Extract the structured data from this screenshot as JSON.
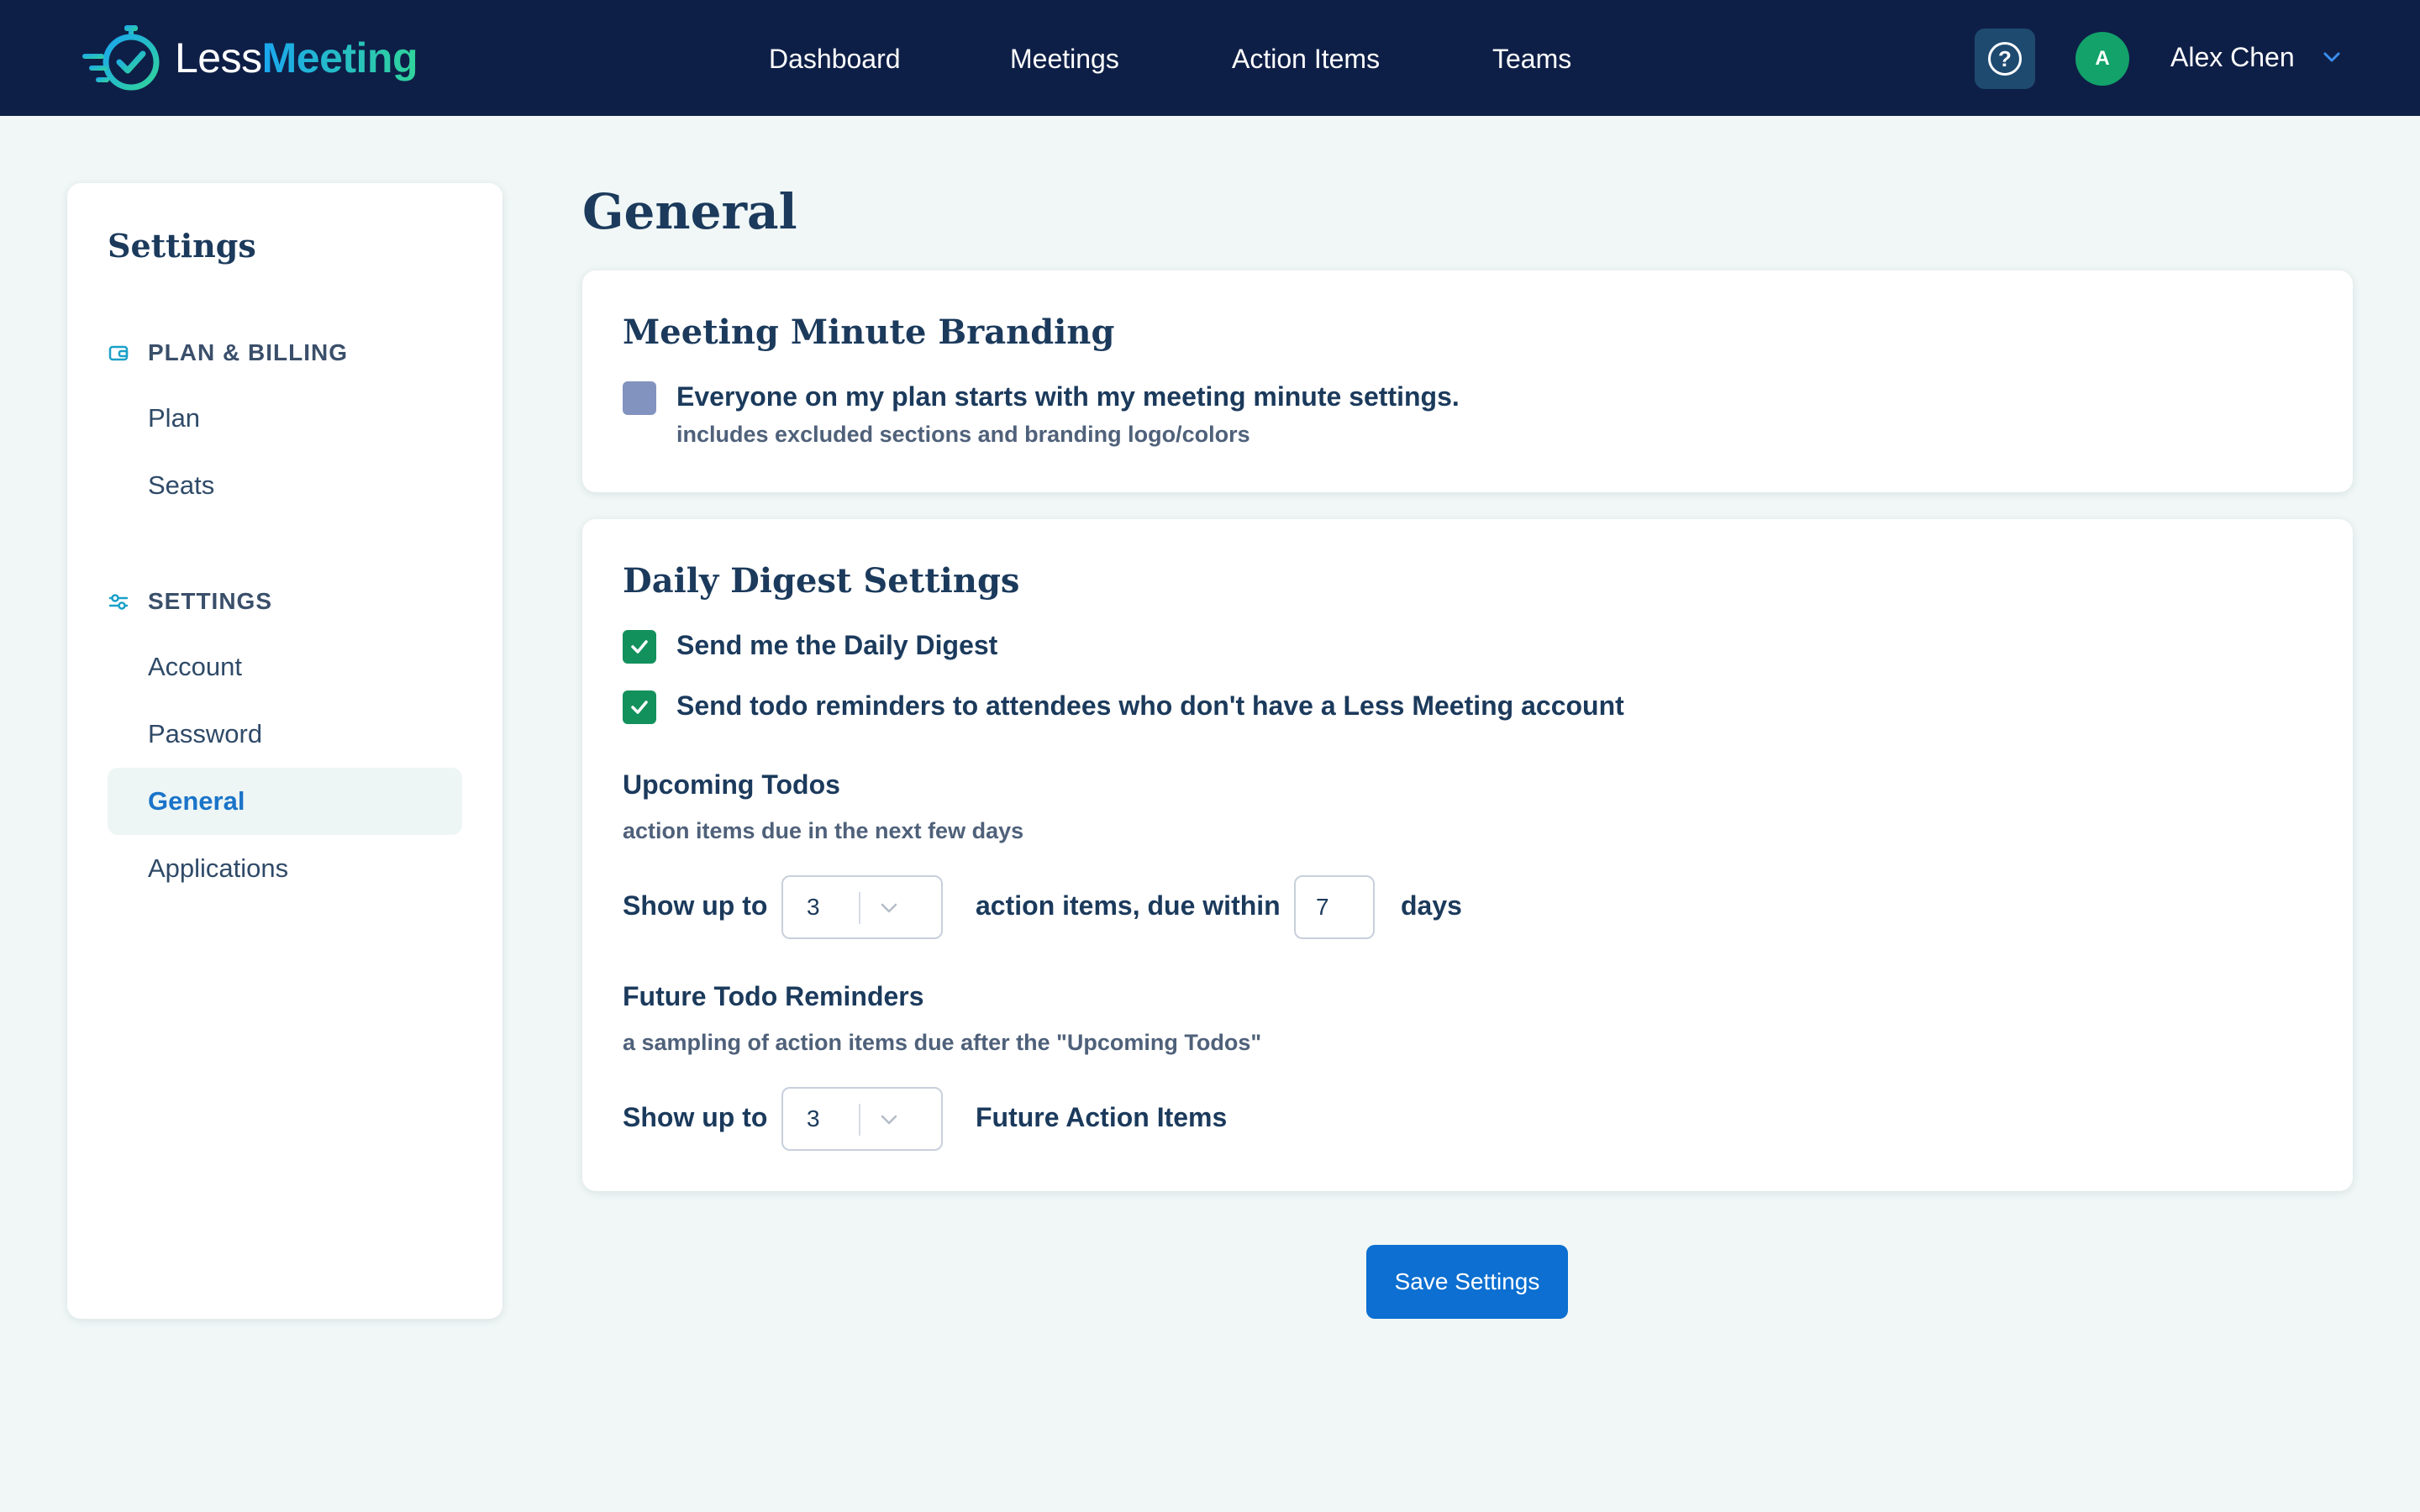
{
  "app": {
    "logo_less": "Less",
    "logo_meeting": "Meeting"
  },
  "nav": {
    "items": [
      {
        "label": "Dashboard"
      },
      {
        "label": "Meetings"
      },
      {
        "label": "Action Items"
      },
      {
        "label": "Teams"
      }
    ]
  },
  "header": {
    "help_icon": "question-circle-icon",
    "avatar_initial": "A",
    "user_name": "Alex Chen"
  },
  "sidebar": {
    "title": "Settings",
    "sections": [
      {
        "heading": "PLAN & BILLING",
        "icon": "wallet-icon",
        "items": [
          {
            "label": "Plan"
          },
          {
            "label": "Seats"
          }
        ]
      },
      {
        "heading": "SETTINGS",
        "icon": "sliders-icon",
        "items": [
          {
            "label": "Account"
          },
          {
            "label": "Password"
          },
          {
            "label": "General",
            "active": true
          },
          {
            "label": "Applications"
          }
        ]
      }
    ]
  },
  "main": {
    "title": "General",
    "branding": {
      "title": "Meeting Minute Branding",
      "checkbox_label": "Everyone on my plan starts with my meeting minute settings.",
      "checkbox_sub": "includes excluded sections and branding logo/colors",
      "checked": false
    },
    "digest": {
      "title": "Daily Digest Settings",
      "options": [
        {
          "label": "Send me the Daily Digest",
          "checked": true
        },
        {
          "label": "Send todo reminders to attendees who don't have a Less Meeting account",
          "checked": true
        }
      ],
      "upcoming": {
        "heading": "Upcoming Todos",
        "desc": "action items due in the next few days",
        "show_up_to": "Show up to",
        "count_value": "3",
        "mid_text": "action items, due within",
        "days_value": "7",
        "days_label": "days"
      },
      "future": {
        "heading": "Future Todo Reminders",
        "desc": "a sampling of action items due after the \"Upcoming Todos\"",
        "show_up_to": "Show up to",
        "count_value": "3",
        "suffix": "Future Action Items"
      }
    },
    "save_label": "Save Settings"
  },
  "colors": {
    "topbar": "#0e1f47",
    "accent": "#0c6fd1",
    "check_green": "#13915c",
    "background": "#f0f7f6"
  }
}
